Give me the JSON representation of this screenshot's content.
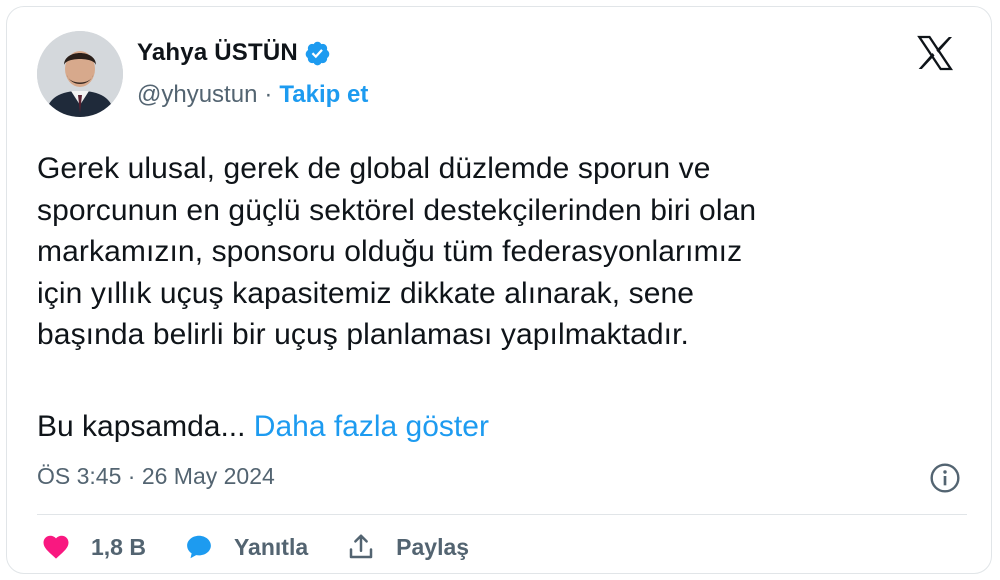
{
  "author": {
    "name": "Yahya ÜSTÜN",
    "handle": "@yhyustun",
    "separator": "·",
    "follow_label": "Takip et"
  },
  "tweet": {
    "text": "Gerek ulusal, gerek de global düzlemde sporun ve\nsporcunun en güçlü sektörel destekçilerinden biri olan\nmarkamızın,  sponsoru olduğu tüm federasyonlarımız\niçin yıllık uçuş kapasitemiz dikkate alınarak, sene\nbaşında belirli bir uçuş planlaması yapılmaktadır.",
    "truncated_text": "Bu kapsamda...",
    "show_more_label": "Daha fazla göster",
    "timestamp": "ÖS 3:45 · 26 May 2024"
  },
  "actions": {
    "like_count": "1,8 B",
    "reply_label": "Yanıtla",
    "share_label": "Paylaş"
  },
  "icons": [
    "verified-badge-icon",
    "x-logo-icon",
    "info-icon",
    "heart-icon",
    "reply-bubble-icon",
    "share-icon"
  ],
  "colors": {
    "accent": "#1d9bf0",
    "like": "#f91880",
    "text": "#0f1419",
    "muted": "#536471",
    "border": "#e1e5e8"
  }
}
